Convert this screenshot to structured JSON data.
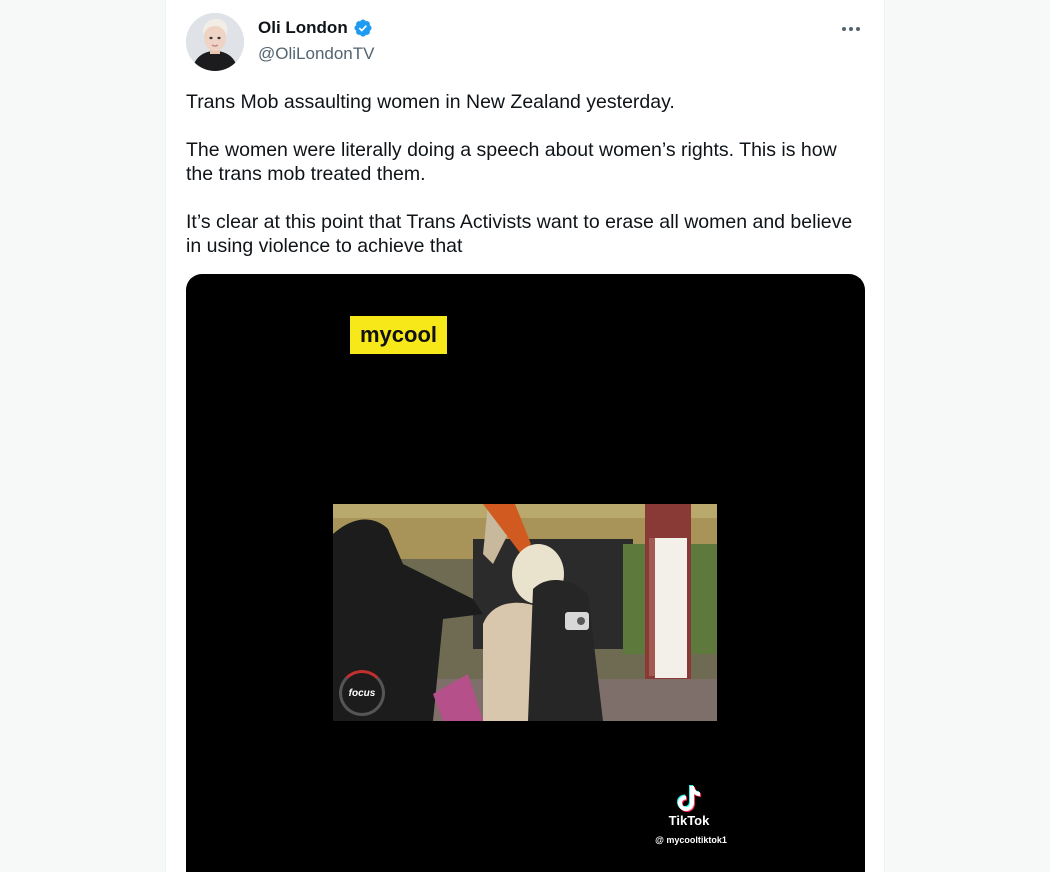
{
  "author": {
    "display_name": "Oli London",
    "handle": "@OliLondonTV",
    "verified": true,
    "verified_color": "#1d9bf0"
  },
  "tweet": {
    "paragraphs": [
      "Trans Mob assaulting women in New Zealand yesterday.",
      "The women were literally doing a speech about women’s rights. This is how the trans mob treated them.",
      "It’s clear at this point that Trans Activists want to erase all women and believe in using violence to achieve that"
    ]
  },
  "media": {
    "type": "video",
    "watermark_tag": "mycool",
    "broadcast_logo": "focus",
    "tiktok_label": "TikTok",
    "tiktok_user": "@ mycooltiktok1"
  },
  "icons": {
    "verified": "verified-badge-icon",
    "more": "more-options-icon",
    "tiktok": "tiktok-logo-icon"
  }
}
